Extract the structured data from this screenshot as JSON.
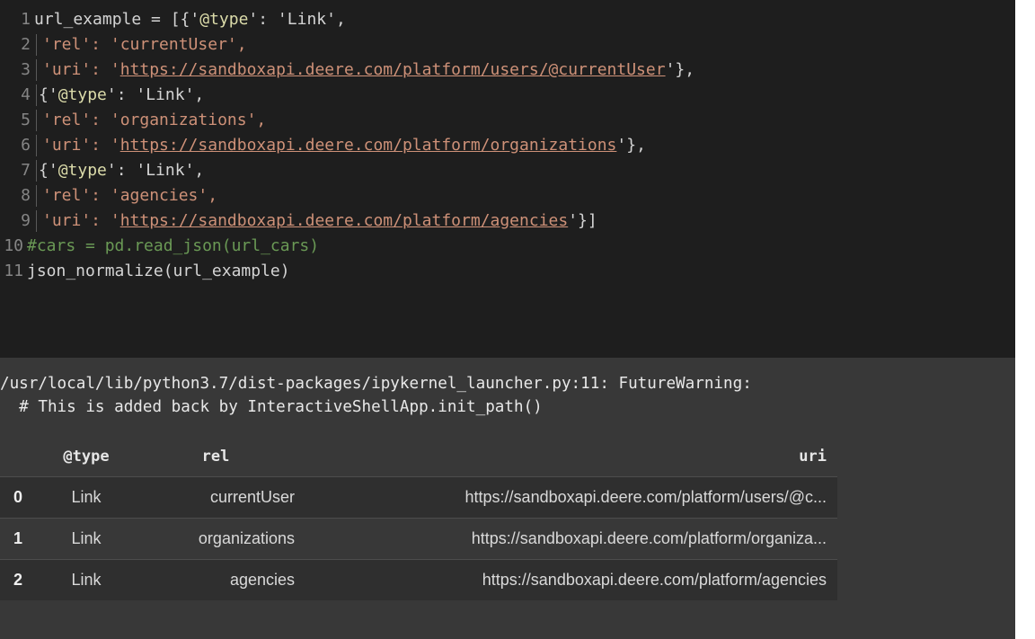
{
  "code": {
    "line_numbers": [
      "1",
      "2",
      "3",
      "4",
      "5",
      "6",
      "7",
      "8",
      "9",
      "10",
      "11"
    ],
    "l1_a": "url_example = [{'",
    "l1_at": "@type",
    "l1_b": "': 'Link',",
    "l2": "'rel': 'currentUser',",
    "l3_a": "'uri': '",
    "l3_url": "https://sandboxapi.deere.com/platform/users/@currentUser",
    "l3_b": "'},",
    "l4_a": "{'",
    "l4_at": "@type",
    "l4_b": "': 'Link',",
    "l5": "'rel': 'organizations',",
    "l6_a": "'uri': '",
    "l6_url": "https://sandboxapi.deere.com/platform/organizations",
    "l6_b": "'},",
    "l7_a": "{'",
    "l7_at": "@type",
    "l7_b": "': 'Link',",
    "l8": "'rel': 'agencies',",
    "l9_a": "'uri': '",
    "l9_url": "https://sandboxapi.deere.com/platform/agencies",
    "l9_b": "'}]",
    "l10": "#cars = pd.read_json(url_cars)",
    "l11": "json_normalize(url_example)"
  },
  "output": {
    "warning_line1": "/usr/local/lib/python3.7/dist-packages/ipykernel_launcher.py:11: FutureWarning:",
    "warning_line2": "  # This is added back by InteractiveShellApp.init_path()"
  },
  "table": {
    "headers": [
      "",
      "@type",
      "rel",
      "uri"
    ],
    "rows": [
      {
        "index": "0",
        "type": "Link",
        "rel": "currentUser",
        "uri": "https://sandboxapi.deere.com/platform/users/@c..."
      },
      {
        "index": "1",
        "type": "Link",
        "rel": "organizations",
        "uri": "https://sandboxapi.deere.com/platform/organiza..."
      },
      {
        "index": "2",
        "type": "Link",
        "rel": "agencies",
        "uri": "https://sandboxapi.deere.com/platform/agencies"
      }
    ]
  },
  "colors": {
    "code_background": "#1e1e1e",
    "output_background": "#383838",
    "string": "#ce9178",
    "comment": "#6a9955"
  }
}
